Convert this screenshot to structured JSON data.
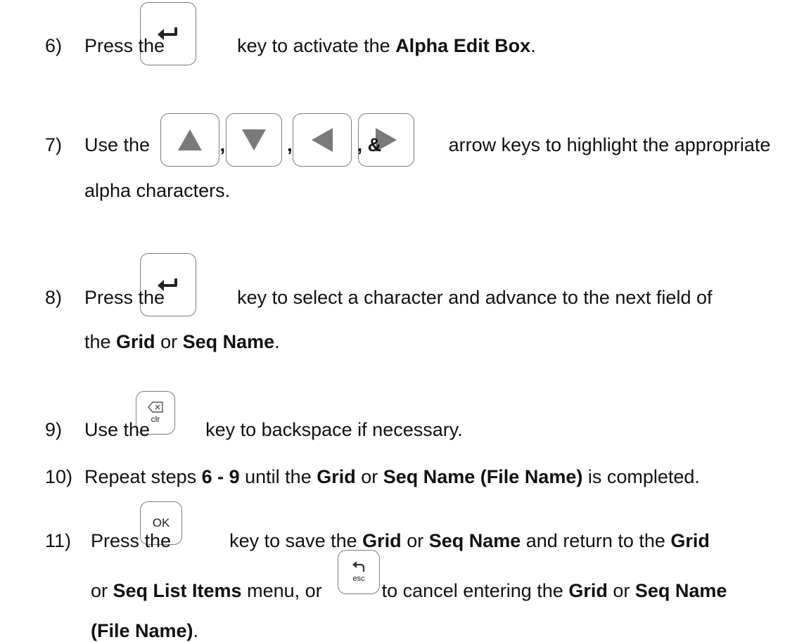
{
  "steps": [
    {
      "num": "6)",
      "parts": [
        {
          "t": "Press the ",
          "b": false
        },
        {
          "key": "enter"
        },
        {
          "t": " key to activate the ",
          "b": false
        },
        {
          "t": "Alpha Edit Box",
          "b": true
        },
        {
          "t": ".",
          "b": false
        }
      ]
    },
    {
      "num": "7)",
      "parts": [
        {
          "t": "Use the ",
          "b": false
        },
        {
          "key": "up"
        },
        {
          "t": ",",
          "b": true
        },
        {
          "key": "down"
        },
        {
          "t": ",",
          "b": true
        },
        {
          "key": "left"
        },
        {
          "t": ", &",
          "b": true
        },
        {
          "key": "right"
        },
        {
          "t": " arrow keys to highlight the appropriate",
          "b": false
        }
      ],
      "cont": [
        {
          "t": "alpha characters.",
          "b": false
        }
      ]
    },
    {
      "num": "8)",
      "parts": [
        {
          "t": "Press the ",
          "b": false
        },
        {
          "key": "enter"
        },
        {
          "t": " key to select a character and advance to the next field of",
          "b": false
        }
      ],
      "cont": [
        {
          "t": "the ",
          "b": false
        },
        {
          "t": "Grid",
          "b": true
        },
        {
          "t": " or ",
          "b": false
        },
        {
          "t": "Seq Name",
          "b": true
        },
        {
          "t": ".",
          "b": false
        }
      ]
    },
    {
      "num": "9)",
      "parts": [
        {
          "t": "Use the ",
          "b": false
        },
        {
          "key": "clr"
        },
        {
          "t": " key to backspace if necessary.",
          "b": false
        }
      ]
    },
    {
      "num": "10)",
      "parts": [
        {
          "t": "Repeat steps ",
          "b": false
        },
        {
          "t": "6 - 9",
          "b": true
        },
        {
          "t": " until the ",
          "b": false
        },
        {
          "t": "Grid",
          "b": true
        },
        {
          "t": " or ",
          "b": false
        },
        {
          "t": "Seq Name (File Name)",
          "b": true
        },
        {
          "t": " is completed.",
          "b": false
        }
      ]
    },
    {
      "num": "11)",
      "parts": [
        {
          "t": "Press the ",
          "b": false
        },
        {
          "key": "ok"
        },
        {
          "t": " key to save the ",
          "b": false
        },
        {
          "t": "Grid",
          "b": true
        },
        {
          "t": " or ",
          "b": false
        },
        {
          "t": "Seq Name",
          "b": true
        },
        {
          "t": " and return to the ",
          "b": false
        },
        {
          "t": "Grid",
          "b": true
        }
      ],
      "cont": [
        {
          "t": "or ",
          "b": false
        },
        {
          "t": "Seq List Items",
          "b": true
        },
        {
          "t": " menu, or ",
          "b": false
        },
        {
          "key": "esc"
        },
        {
          "t": " to cancel entering the ",
          "b": false
        },
        {
          "t": "Grid",
          "b": true
        },
        {
          "t": " or ",
          "b": false
        },
        {
          "t": "Seq Name",
          "b": true
        }
      ],
      "cont2": [
        {
          "t": "(File Name)",
          "b": true
        },
        {
          "t": ".",
          "b": false
        }
      ]
    }
  ],
  "keys": {
    "enter": {
      "icon": "enter-arrow-icon"
    },
    "up": {
      "icon": "up-triangle-icon"
    },
    "down": {
      "icon": "down-triangle-icon"
    },
    "left": {
      "icon": "left-triangle-icon"
    },
    "right": {
      "icon": "right-triangle-icon"
    },
    "clr": {
      "icon": "backspace-icon",
      "label": "clr"
    },
    "ok": {
      "label": "OK"
    },
    "esc": {
      "icon": "return-arrow-icon",
      "label": "esc"
    }
  },
  "colors": {
    "text": "#111111",
    "key_border": "#7d7d7d",
    "icon": "#7a7a7a"
  }
}
